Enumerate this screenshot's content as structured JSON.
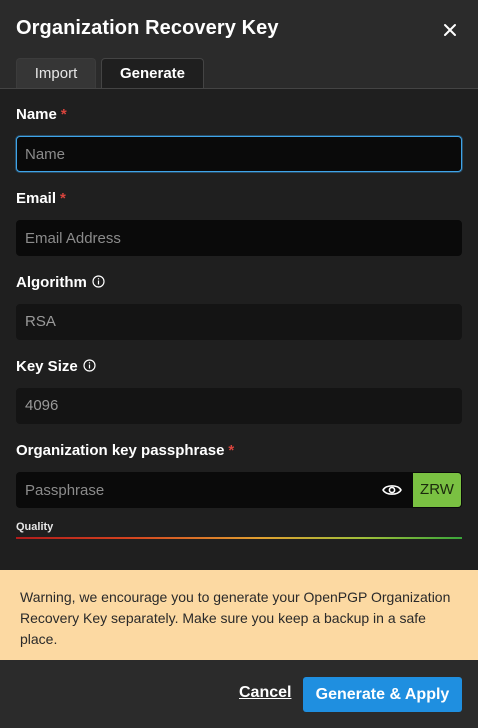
{
  "dialog": {
    "title": "Organization Recovery Key"
  },
  "tabs": [
    {
      "label": "Import",
      "active": false
    },
    {
      "label": "Generate",
      "active": true
    }
  ],
  "form": {
    "name": {
      "label": "Name",
      "required_mark": "*",
      "placeholder": "Name",
      "value": ""
    },
    "email": {
      "label": "Email",
      "required_mark": "*",
      "placeholder": "Email Address",
      "value": ""
    },
    "algorithm": {
      "label": "Algorithm",
      "value": "RSA"
    },
    "key_size": {
      "label": "Key Size",
      "value": "4096"
    },
    "passphrase": {
      "label": "Organization key passphrase",
      "required_mark": "*",
      "placeholder": "Passphrase",
      "value": "",
      "strength_badge": "ZRW"
    },
    "quality_label": "Quality"
  },
  "warning": {
    "text": "Warning, we encourage you to generate your OpenPGP Organization Recovery Key separately. Make sure you keep a backup in a safe place."
  },
  "footer": {
    "cancel_label": "Cancel",
    "apply_label": "Generate & Apply"
  },
  "colors": {
    "background": "#2b2b2b",
    "content": "#1f1f1f",
    "input": "#0a0a0a",
    "required": "#d9443d",
    "focus": "#3fa4e9",
    "primary": "#1f8fe0",
    "warning_bg": "#fcd9a2",
    "strength": "#7ac142"
  },
  "icons": {
    "close": "close-icon",
    "info": "info-icon",
    "eye": "eye-icon"
  }
}
